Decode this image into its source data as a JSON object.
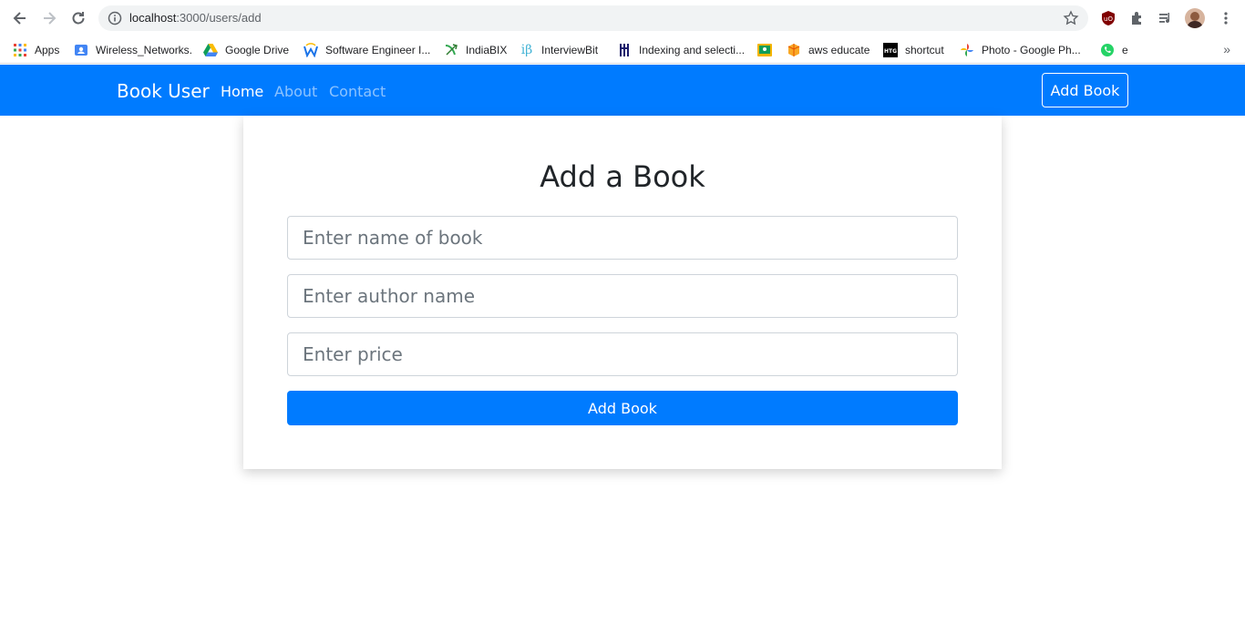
{
  "browser": {
    "url_host": "localhost",
    "url_rest": ":3000/users/add",
    "bookmarks": [
      {
        "label": "Apps",
        "icon": "apps-grid-icon",
        "color": "#ea4335"
      },
      {
        "label": "Wireless_Networks.",
        "icon": "contact-card-icon",
        "color": "#4285f4"
      },
      {
        "label": "Google Drive",
        "icon": "google-drive-icon",
        "color": "#0f9d58"
      },
      {
        "label": "Software Engineer I...",
        "icon": "w-logo-icon",
        "color": "#1a73e8"
      },
      {
        "label": "IndiaBIX",
        "icon": "indiabix-icon",
        "color": "#34a853"
      },
      {
        "label": "InterviewBit",
        "icon": "interviewbit-icon",
        "color": "#42b3d5"
      },
      {
        "label": "Indexing and selecti...",
        "icon": "bookmark-icon",
        "color": "#1b1b6b"
      },
      {
        "label": "",
        "icon": "classroom-icon",
        "color": "#f4b400"
      },
      {
        "label": "aws educate",
        "icon": "aws-box-icon",
        "color": "#f9a825"
      },
      {
        "label": "shortcut",
        "icon": "htg-icon",
        "color": "#000000"
      },
      {
        "label": "Photo - Google Ph...",
        "icon": "google-photos-icon",
        "color": "#ea4335"
      },
      {
        "label": "e",
        "icon": "whatsapp-icon",
        "color": "#25d366"
      }
    ]
  },
  "navbar": {
    "brand": "Book User",
    "links": [
      "Home",
      "About",
      "Contact"
    ],
    "cta": "Add Book",
    "bg": "#007bff"
  },
  "form": {
    "title": "Add a Book",
    "name_placeholder": "Enter name of book",
    "author_placeholder": "Enter author name",
    "price_placeholder": "Enter price",
    "submit": "Add Book"
  }
}
